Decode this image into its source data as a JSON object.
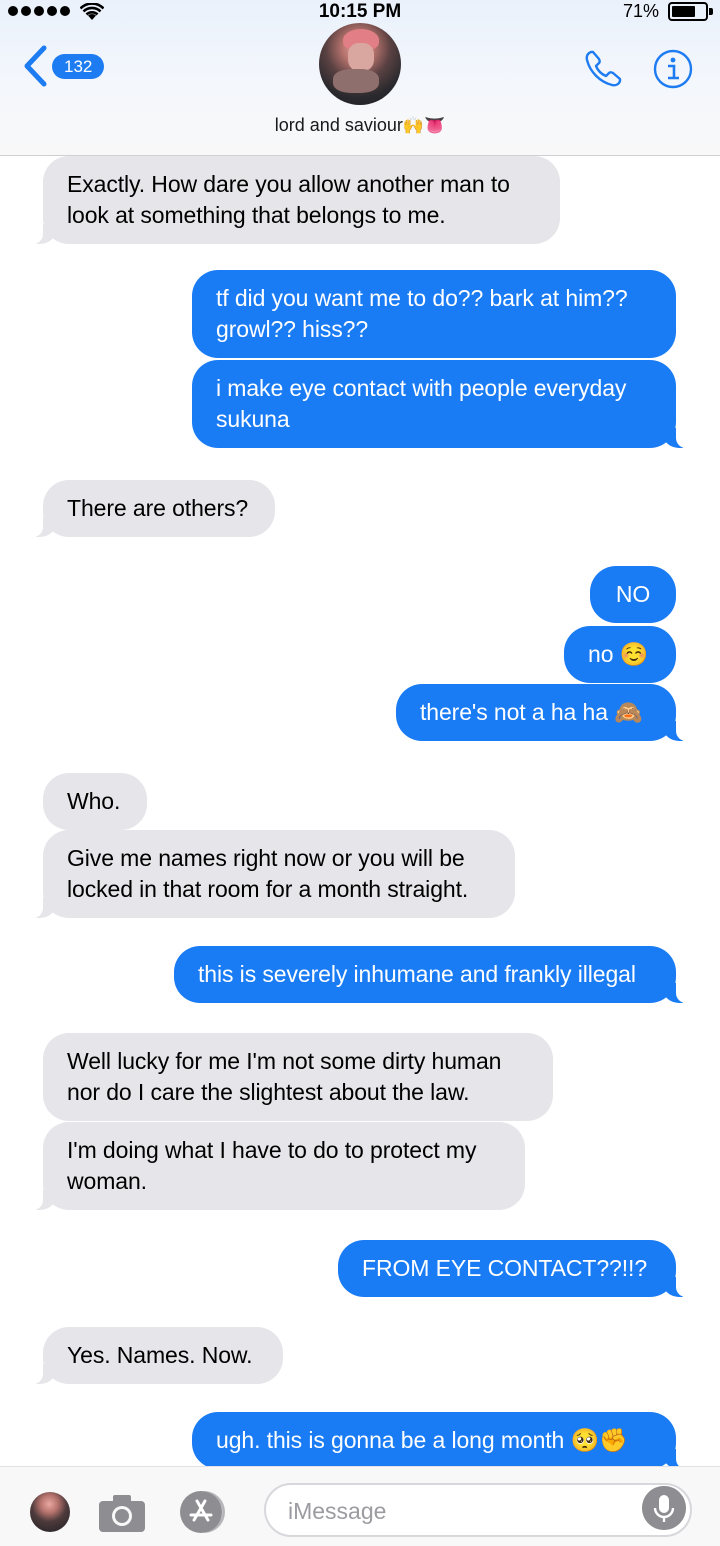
{
  "status_bar": {
    "time": "10:15 PM",
    "battery_percent": "71%",
    "battery_level": 0.71
  },
  "header": {
    "back_count": "132",
    "contact_name": "lord and saviour",
    "contact_emoji": "🙌👅"
  },
  "colors": {
    "accent": "#1a7cf5",
    "incoming_bubble": "#e5e5ea",
    "outgoing_bubble": "#1a7cf5"
  },
  "messages": [
    {
      "from": "them",
      "text": "Exactly. How dare you allow another man to\nlook at something that belongs to me."
    },
    {
      "from": "me",
      "text": "tf did you want me to do?? bark at him??\ngrowl?? hiss??"
    },
    {
      "from": "me",
      "text": "i make eye contact with people everyday\nsukuna"
    },
    {
      "from": "them",
      "text": "There are others?"
    },
    {
      "from": "me",
      "text": "NO"
    },
    {
      "from": "me",
      "text": "no ☺️"
    },
    {
      "from": "me",
      "text": "there's not a ha ha 🙈"
    },
    {
      "from": "them",
      "text": "Who."
    },
    {
      "from": "them",
      "text": "Give me names right now or you will be\nlocked in that room for a month straight."
    },
    {
      "from": "me",
      "text": "this is severely inhumane and frankly illegal"
    },
    {
      "from": "them",
      "text": "Well lucky for me I'm not some dirty human\nnor do I care the slightest about the law."
    },
    {
      "from": "them",
      "text": "I'm doing what I have to do to protect my\nwoman."
    },
    {
      "from": "me",
      "text": "FROM EYE CONTACT??!!?"
    },
    {
      "from": "them",
      "text": "Yes. Names. Now."
    },
    {
      "from": "me",
      "text": "ugh. this is gonna be a long month 🥺✊"
    }
  ],
  "input": {
    "placeholder": "iMessage",
    "value": ""
  },
  "icons": [
    "back-chevron-icon",
    "phone-icon",
    "info-icon",
    "camera-icon",
    "appstore-icon",
    "microphone-icon",
    "wifi-icon",
    "battery-icon"
  ]
}
